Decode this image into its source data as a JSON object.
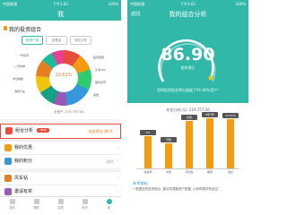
{
  "left": {
    "status": {
      "signal": "中国联通",
      "time": "下午1:02",
      "battery": "100%"
    },
    "title": "我",
    "section_title": "我的投资组合",
    "tabs": [
      "按资产类",
      "按基金",
      "风险分析"
    ],
    "pie": {
      "center": "10.61%",
      "labels": [
        "一号货币",
        "二号债券",
        "中证指数",
        "消费行业",
        "医药健康",
        "沪深300",
        "银华货币",
        "其他"
      ],
      "colors": [
        "#e74c3c",
        "#f39c12",
        "#2ecc71",
        "#3498db",
        "#9b59b6",
        "#16a085",
        "#f1c40f",
        "#e67e22",
        "#1abc9c",
        "#e84393"
      ]
    },
    "total": "总资产: 219,757.56",
    "menu": [
      {
        "label": "组合分析",
        "badge": "NEW",
        "value": "组合得分 86.9",
        "color": "#e74c3c"
      },
      {
        "label": "我的优惠",
        "value": "",
        "color": "#f39c12"
      },
      {
        "label": "我的积分",
        "value": "600",
        "color": "#3498db"
      },
      {
        "label": "风车钻",
        "value": "",
        "color": "#e67e22"
      },
      {
        "label": "邀请有奖",
        "value": "",
        "color": "#9b59b6"
      }
    ],
    "tabbar": [
      "首页",
      "理财",
      "发现",
      "资讯",
      "我"
    ]
  },
  "right": {
    "status": {
      "signal": "中国联通",
      "time": "下午1:02",
      "battery": "100%"
    },
    "title": "我的组合分析",
    "back": "返回",
    "score": "86.90",
    "score_label": "组合得分",
    "beat_text": "您的投资组合得分超越了91.80%用户!",
    "chart_title": "本金分析(元): 219,757.56",
    "bars": [
      {
        "label": "5%",
        "x": "收益率",
        "value": 62
      },
      {
        "label": "可能",
        "x": "风险",
        "value": 48
      },
      {
        "label": "比较",
        "x": "流动性",
        "value": 92
      },
      {
        "label": "5年7年",
        "x": "期限",
        "value": 96
      },
      {
        "label": "10.61%",
        "x": "收益",
        "value": 94
      }
    ],
    "ref_title": "参考指标",
    "ref_text": "• 根据您的投资组合, 建议您调整资产配置, 以获得更好的收益"
  }
}
